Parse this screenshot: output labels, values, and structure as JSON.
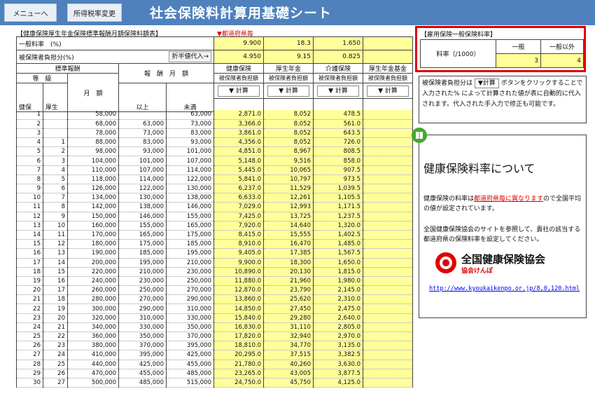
{
  "header": {
    "menu_button": "メニューへ",
    "rate_button": "所得税率変更",
    "title": "社会保険料計算用基礎シート"
  },
  "caption": "【健康保険厚生年金保険標準報酬月額保険料額表】",
  "pref_note": "▼都道府県毎",
  "rates": {
    "general_label": "一般料率　(%)",
    "general": [
      "9.900",
      "18.3",
      "1.650",
      ""
    ],
    "insured_label": "被保険者負担分(%)",
    "half_button": "折半値代入→",
    "insured": [
      "4.950",
      "9.15",
      "0.825",
      ""
    ]
  },
  "headers": {
    "standard": "標準報酬",
    "grade": "等　級",
    "health": "健保",
    "pension": "厚生",
    "monthly_amount": "月　額",
    "remuneration": "報　酬　月　額",
    "min": "以上",
    "max": "未満",
    "col_health": "健康保険",
    "col_pension": "厚生年金",
    "col_care": "介護保険",
    "col_fund": "厚生年金基金",
    "insured_amount": "被保険者負担額",
    "calc_button": "▼ 計算"
  },
  "rows": [
    [
      "1",
      "",
      "58,000",
      "",
      "63,000",
      "2,871.0",
      "8,052",
      "478.5",
      ""
    ],
    [
      "2",
      "",
      "68,000",
      "63,000",
      "73,000",
      "3,366.0",
      "8,052",
      "561.0",
      ""
    ],
    [
      "3",
      "",
      "78,000",
      "73,000",
      "83,000",
      "3,861.0",
      "8,052",
      "643.5",
      ""
    ],
    [
      "4",
      "1",
      "88,000",
      "83,000",
      "93,000",
      "4,356.0",
      "8,052",
      "726.0",
      ""
    ],
    [
      "5",
      "2",
      "98,000",
      "93,000",
      "101,000",
      "4,851.0",
      "8,967",
      "808.5",
      ""
    ],
    [
      "6",
      "3",
      "104,000",
      "101,000",
      "107,000",
      "5,148.0",
      "9,516",
      "858.0",
      ""
    ],
    [
      "7",
      "4",
      "110,000",
      "107,000",
      "114,000",
      "5,445.0",
      "10,065",
      "907.5",
      ""
    ],
    [
      "8",
      "5",
      "118,000",
      "114,000",
      "122,000",
      "5,841.0",
      "10,797",
      "973.5",
      ""
    ],
    [
      "9",
      "6",
      "126,000",
      "122,000",
      "130,000",
      "6,237.0",
      "11,529",
      "1,039.5",
      ""
    ],
    [
      "10",
      "7",
      "134,000",
      "130,000",
      "138,000",
      "6,633.0",
      "12,261",
      "1,105.5",
      ""
    ],
    [
      "11",
      "8",
      "142,000",
      "138,000",
      "146,000",
      "7,029.0",
      "12,993",
      "1,171.5",
      ""
    ],
    [
      "12",
      "9",
      "150,000",
      "146,000",
      "155,000",
      "7,425.0",
      "13,725",
      "1,237.5",
      ""
    ],
    [
      "13",
      "10",
      "160,000",
      "155,000",
      "165,000",
      "7,920.0",
      "14,640",
      "1,320.0",
      ""
    ],
    [
      "14",
      "11",
      "170,000",
      "165,000",
      "175,000",
      "8,415.0",
      "15,555",
      "1,402.5",
      ""
    ],
    [
      "15",
      "12",
      "180,000",
      "175,000",
      "185,000",
      "8,910.0",
      "16,470",
      "1,485.0",
      ""
    ],
    [
      "16",
      "13",
      "190,000",
      "185,000",
      "195,000",
      "9,405.0",
      "17,385",
      "1,567.5",
      ""
    ],
    [
      "17",
      "14",
      "200,000",
      "195,000",
      "210,000",
      "9,900.0",
      "18,300",
      "1,650.0",
      ""
    ],
    [
      "18",
      "15",
      "220,000",
      "210,000",
      "230,000",
      "10,890.0",
      "20,130",
      "1,815.0",
      ""
    ],
    [
      "19",
      "16",
      "240,000",
      "230,000",
      "250,000",
      "11,880.0",
      "21,960",
      "1,980.0",
      ""
    ],
    [
      "20",
      "17",
      "260,000",
      "250,000",
      "270,000",
      "12,870.0",
      "23,790",
      "2,145.0",
      ""
    ],
    [
      "21",
      "18",
      "280,000",
      "270,000",
      "290,000",
      "13,860.0",
      "25,620",
      "2,310.0",
      ""
    ],
    [
      "22",
      "19",
      "300,000",
      "290,000",
      "310,000",
      "14,850.0",
      "27,450",
      "2,475.0",
      ""
    ],
    [
      "23",
      "20",
      "320,000",
      "310,000",
      "330,000",
      "15,840.0",
      "29,280",
      "2,640.0",
      ""
    ],
    [
      "24",
      "21",
      "340,000",
      "330,000",
      "350,000",
      "16,830.0",
      "31,110",
      "2,805.0",
      ""
    ],
    [
      "25",
      "22",
      "360,000",
      "350,000",
      "370,000",
      "17,820.0",
      "32,940",
      "2,970.0",
      ""
    ],
    [
      "26",
      "23",
      "380,000",
      "370,000",
      "395,000",
      "18,810.0",
      "34,770",
      "3,135.0",
      ""
    ],
    [
      "27",
      "24",
      "410,000",
      "395,000",
      "425,000",
      "20,295.0",
      "37,515",
      "3,382.5",
      ""
    ],
    [
      "28",
      "25",
      "440,000",
      "425,000",
      "455,000",
      "21,780.0",
      "40,260",
      "3,630.0",
      ""
    ],
    [
      "29",
      "26",
      "470,000",
      "455,000",
      "485,000",
      "23,265.0",
      "43,005",
      "3,877.5",
      ""
    ],
    [
      "30",
      "27",
      "500,000",
      "485,000",
      "515,000",
      "24,750.0",
      "45,750",
      "4,125.0",
      ""
    ]
  ],
  "employment": {
    "title": "【雇用保険一般保険料率】",
    "rate_label": "料率（/1000）",
    "general_label": "一般",
    "other_label": "一般以外",
    "general_value": "3",
    "other_value": "4"
  },
  "note": {
    "pre": "被保険者負担分は",
    "button": "▼計算",
    "post": "ボタンをクリックすることで入力された% によって計算された値が表に自動的に代入されます。代入された手入力で修正も可能です。"
  },
  "info": {
    "title": "健康保険料率について",
    "p1_pre": "健康保険の料率は",
    "p1_link": "都道府県毎に異なります",
    "p1_post": "ので全国平均の値が設定されています。",
    "p2": "全国健康保険協会のサイトを参照して、貴社の該当する都道府県の保険料率を設定してください。",
    "logo_name": "全国健康保険協会",
    "logo_sub": "協会けんぽ",
    "url": "http://www.kyoukaikenpo.or.jp/8,0,120.html"
  },
  "colors": {
    "header_blue": "#4f81bd",
    "cell_yellow": "#ffff99",
    "accent_red": "#e00000"
  }
}
